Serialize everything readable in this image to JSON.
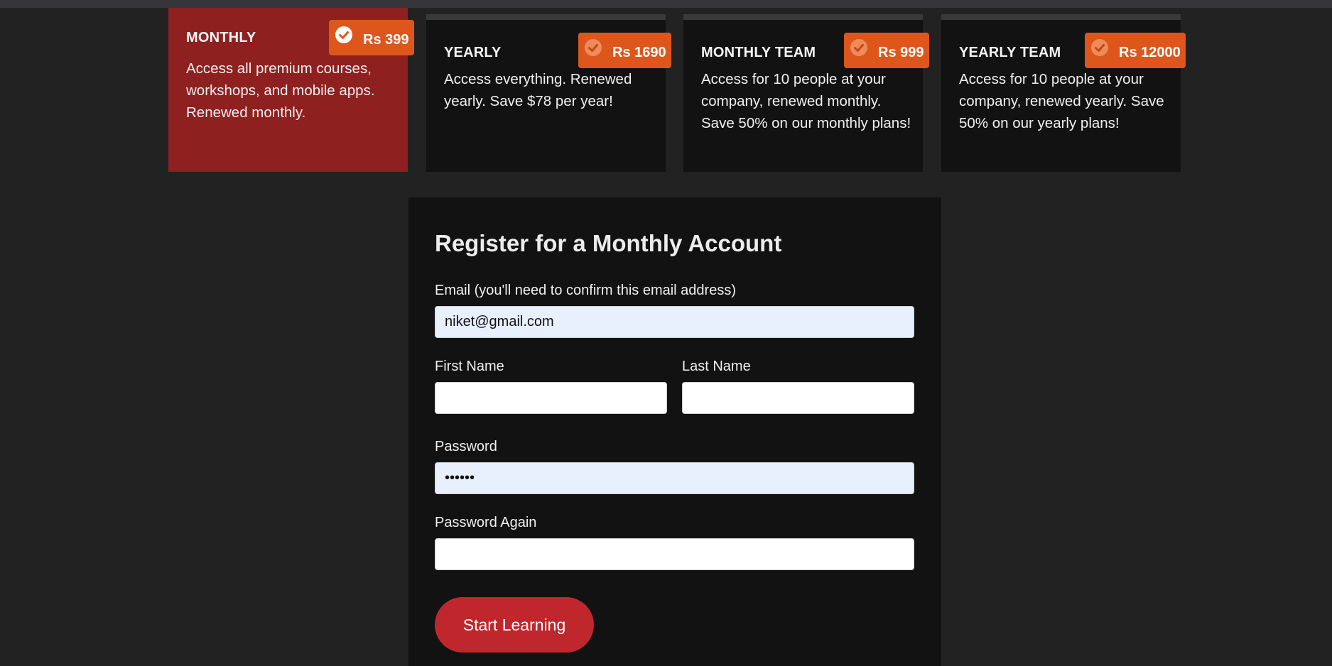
{
  "plans": [
    {
      "name": "MONTHLY",
      "price": "Rs 399",
      "description": "Access all premium courses, workshops, and mobile apps. Renewed monthly.",
      "selected": true
    },
    {
      "name": "YEARLY",
      "price": "Rs 1690",
      "description": "Access everything. Renewed yearly. Save $78 per year!",
      "selected": false
    },
    {
      "name": "MONTHLY TEAM",
      "price": "Rs 999",
      "description": "Access for 10 people at your company, renewed monthly. Save 50% on our monthly plans!",
      "selected": false
    },
    {
      "name": "YEARLY TEAM",
      "price": "Rs 12000",
      "description": "Access for 10 people at your company, renewed yearly. Save 50% on our yearly plans!",
      "selected": false
    }
  ],
  "form": {
    "title": "Register for a Monthly Account",
    "email_label": "Email (you'll need to confirm this email address)",
    "email_value": "niket@gmail.com",
    "first_name_label": "First Name",
    "first_name_value": "",
    "last_name_label": "Last Name",
    "last_name_value": "",
    "password_label": "Password",
    "password_value": "••••••",
    "password_again_label": "Password Again",
    "password_again_value": "",
    "submit_label": "Start Learning"
  },
  "colors": {
    "background": "#222222",
    "selected_plan": "#8f2020",
    "badge": "#dd571c",
    "button": "#c0272d"
  },
  "icons": {
    "badge_icon": "check-circle-icon"
  }
}
